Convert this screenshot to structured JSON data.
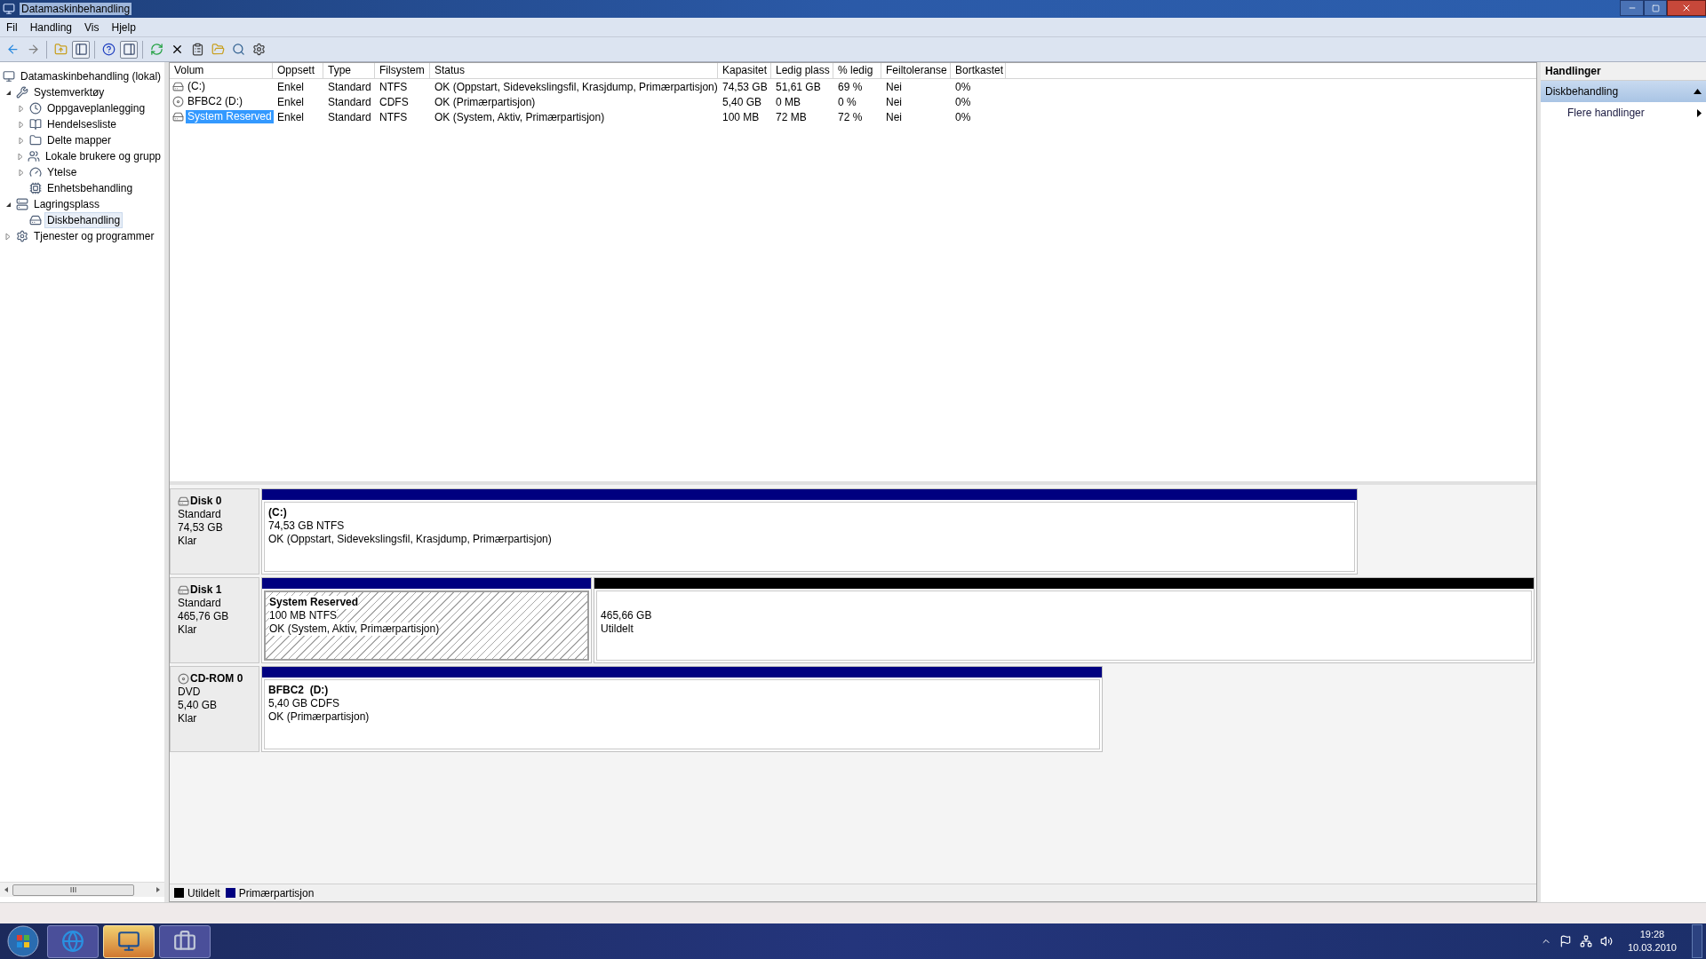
{
  "window": {
    "title": "Datamaskinbehandling"
  },
  "menu": [
    "Fil",
    "Handling",
    "Vis",
    "Hjelp"
  ],
  "toolbar": [
    {
      "pressed": false
    },
    {
      "pressed": false
    },
    {
      "pressed": false
    },
    {
      "pressed": true
    },
    {
      "pressed": false
    },
    {
      "pressed": true
    },
    {
      "pressed": false
    },
    {
      "pressed": false
    },
    {
      "pressed": false
    },
    {
      "pressed": false
    },
    {
      "pressed": false
    },
    {
      "pressed": false
    }
  ],
  "tree": [
    {
      "label": "Datamaskinbehandling (lokal)",
      "selected": false,
      "children": [
        {
          "label": "Systemverktøy",
          "expanded": true,
          "selected": false,
          "children": [
            {
              "label": "Oppgaveplanlegging",
              "expanded": false,
              "selected": false
            },
            {
              "label": "Hendelsesliste",
              "expanded": false,
              "selected": false
            },
            {
              "label": "Delte mapper",
              "expanded": false,
              "selected": false
            },
            {
              "label": "Lokale brukere og grupp",
              "expanded": false,
              "selected": false
            },
            {
              "label": "Ytelse",
              "expanded": false,
              "selected": false
            },
            {
              "label": "Enhetsbehandling",
              "selected": false
            }
          ]
        },
        {
          "label": "Lagringsplass",
          "expanded": true,
          "selected": false,
          "children": [
            {
              "label": "Diskbehandling",
              "selected": true
            }
          ]
        },
        {
          "label": "Tjenester og programmer",
          "expanded": false,
          "selected": false
        }
      ]
    }
  ],
  "table": {
    "columns": [
      "Volum",
      "Oppsett",
      "Type",
      "Filsystem",
      "Status",
      "Kapasitet",
      "Ledig plass",
      "% ledig",
      "Feiltoleranse",
      "Bortkastet"
    ],
    "rows": [
      {
        "kind": "disk",
        "selected": false,
        "cells": [
          "(C:)",
          "Enkel",
          "Standard",
          "NTFS",
          "OK (Oppstart, Sidevekslingsfil, Krasjdump, Primærpartisjon)",
          "74,53 GB",
          "51,61 GB",
          "69 %",
          "Nei",
          "0%"
        ]
      },
      {
        "kind": "cdrom",
        "selected": false,
        "cells": [
          "BFBC2 (D:)",
          "Enkel",
          "Standard",
          "CDFS",
          "OK (Primærpartisjon)",
          "5,40 GB",
          "0 MB",
          "0 %",
          "Nei",
          "0%"
        ]
      },
      {
        "kind": "disk",
        "selected": true,
        "cells": [
          "System Reserved",
          "Enkel",
          "Standard",
          "NTFS",
          "OK (System, Aktiv, Primærpartisjon)",
          "100 MB",
          "72 MB",
          "72 %",
          "Nei",
          "0%"
        ]
      }
    ]
  },
  "disks": [
    {
      "kind": "disk",
      "name": "Disk 0",
      "type": "Standard",
      "size": "74,53 GB",
      "state": "Klar",
      "partitions": [
        {
          "kind": "primary",
          "selected": false,
          "name": "(C:)",
          "size": "74,53 GB NTFS",
          "status": "OK (Oppstart, Sidevekslingsfil, Krasjdump, Primærpartisjon)"
        }
      ]
    },
    {
      "kind": "disk",
      "name": "Disk 1",
      "type": "Standard",
      "size": "465,76 GB",
      "state": "Klar",
      "partitions": [
        {
          "kind": "primary",
          "selected": true,
          "name": "System Reserved",
          "size": "100 MB NTFS",
          "status": "OK (System, Aktiv, Primærpartisjon)"
        },
        {
          "kind": "unallocated",
          "selected": false,
          "size": "465,66 GB",
          "status": "Utildelt"
        }
      ]
    },
    {
      "kind": "cdrom",
      "name": "CD-ROM 0",
      "type": "DVD",
      "size": "5,40 GB",
      "state": "Klar",
      "partitions": [
        {
          "kind": "primary",
          "selected": false,
          "name": "BFBC2  (D:)",
          "size": "5,40 GB CDFS",
          "status": "OK (Primærpartisjon)"
        }
      ]
    }
  ],
  "legend": [
    {
      "label": "Utildelt",
      "color": "#000000"
    },
    {
      "label": "Primærpartisjon",
      "color": "#000080"
    }
  ],
  "actions": {
    "title": "Handlinger",
    "section": {
      "label": "Diskbehandling",
      "expanded": true
    },
    "items": [
      "Flere handlinger"
    ]
  },
  "taskbar": {
    "apps": [
      {
        "active": false
      },
      {
        "active": true
      },
      {
        "active": false
      }
    ],
    "time": "19:28",
    "date": "10.03.2010"
  }
}
